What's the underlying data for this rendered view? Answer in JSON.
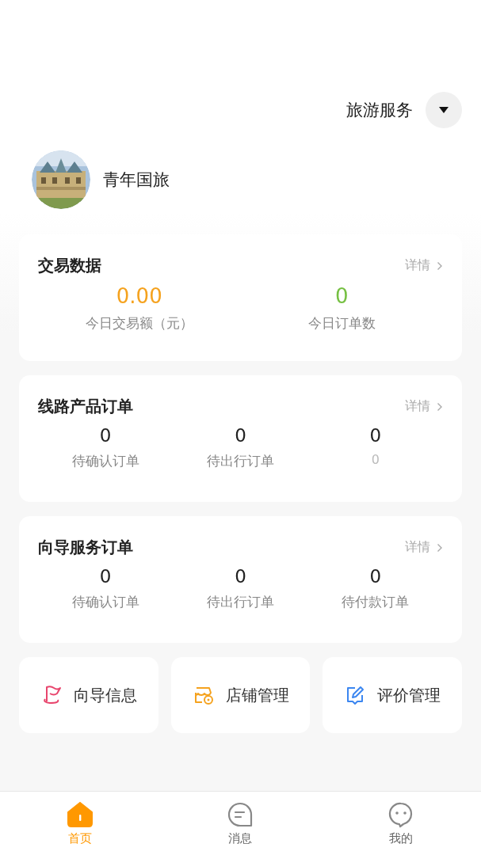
{
  "header": {
    "service_selector": "旅游服务"
  },
  "profile": {
    "name": "青年国旅"
  },
  "cards": [
    {
      "title": "交易数据",
      "detail_link": "详情",
      "stats": [
        {
          "value": "0.00",
          "label": "今日交易额（元）",
          "color": "#f5a21e"
        },
        {
          "value": "0",
          "label": "今日订单数",
          "color": "#76c043"
        }
      ]
    },
    {
      "title": "线路产品订单",
      "detail_link": "详情",
      "stats": [
        {
          "value": "0",
          "label": "待确认订单"
        },
        {
          "value": "0",
          "label": "待出行订单"
        },
        {
          "value": "0",
          "label": "0"
        }
      ]
    },
    {
      "title": "向导服务订单",
      "detail_link": "详情",
      "stats": [
        {
          "value": "0",
          "label": "待确认订单"
        },
        {
          "value": "0",
          "label": "待出行订单"
        },
        {
          "value": "0",
          "label": "待付款订单"
        }
      ]
    }
  ],
  "shortcuts": [
    {
      "kind": "guide",
      "label": "向导信息"
    },
    {
      "kind": "shop",
      "label": "店铺管理"
    },
    {
      "kind": "review",
      "label": "评价管理"
    }
  ],
  "tab_bar": [
    {
      "kind": "home",
      "label": "首页",
      "selected": true
    },
    {
      "kind": "message",
      "label": "消息",
      "selected": false
    },
    {
      "kind": "profile",
      "label": "我的",
      "selected": false
    }
  ]
}
